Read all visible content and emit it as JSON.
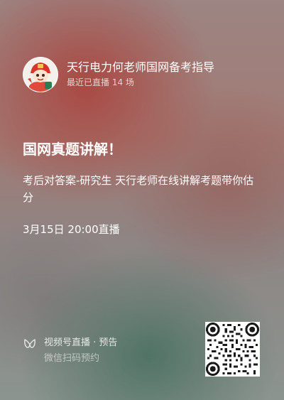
{
  "header": {
    "account_name": "天行电力何老师国网备考指导",
    "live_count": "最近已直播 14 场",
    "avatar_icon": "cartoon-mascot-avatar"
  },
  "post": {
    "title": "国网真题讲解！",
    "description": "考后对答案-研究生 天行老师在线讲解考题带你估分",
    "schedule": "3月15日 20:00直播"
  },
  "footer": {
    "icon": "channels-butterfly-icon",
    "label": "视频号直播 · 预告",
    "hint": "微信扫码预约"
  },
  "qr": {
    "icon": "qr-code"
  }
}
